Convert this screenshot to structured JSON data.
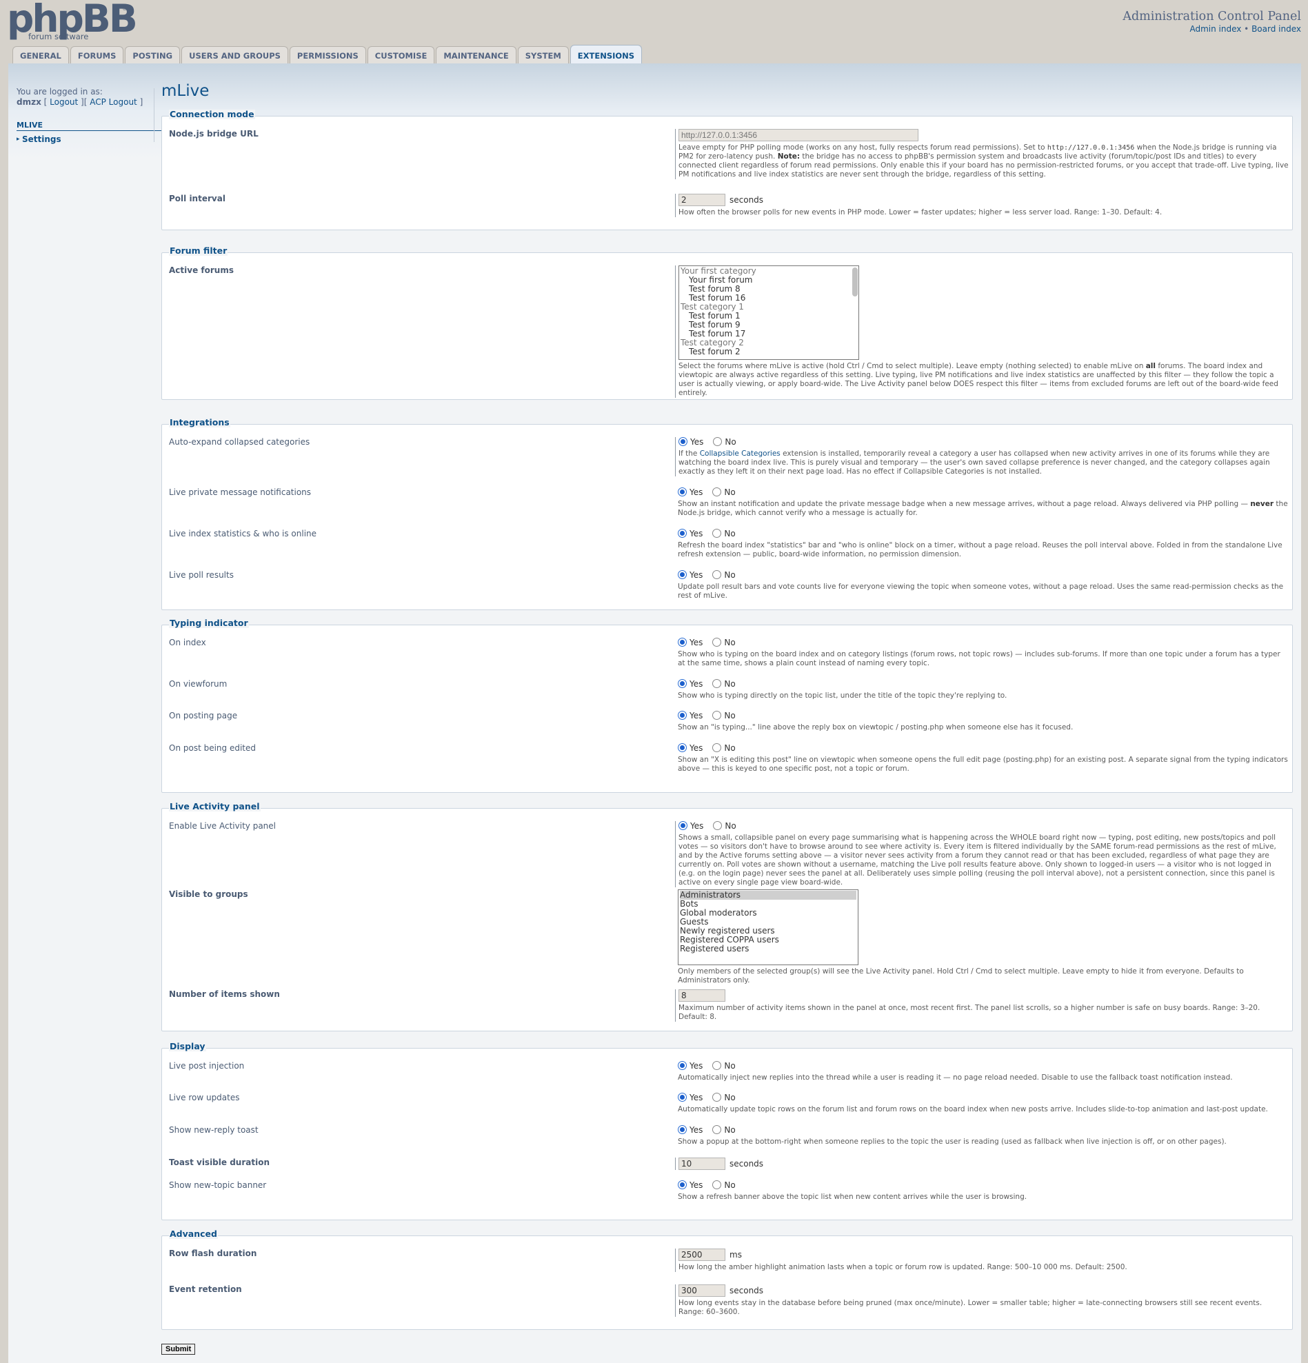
{
  "header": {
    "logo_text": "phpBB",
    "logo_sub": "forum software",
    "logo_reg": "®",
    "title": "Administration Control Panel",
    "link_admin": "Admin index",
    "separator": "•",
    "link_board": "Board index"
  },
  "tabs": [
    "GENERAL",
    "FORUMS",
    "POSTING",
    "USERS AND GROUPS",
    "PERMISSIONS",
    "CUSTOMISE",
    "MAINTENANCE",
    "SYSTEM",
    "EXTENSIONS"
  ],
  "menu": {
    "logged_in_label": "You are logged in as:",
    "username": "dmzx",
    "logout": "Logout",
    "acp_logout": "ACP Logout",
    "section": "MLIVE",
    "item": "Settings"
  },
  "page_title": "mLive",
  "sections": {
    "connection": {
      "legend": "Connection mode",
      "bridge": {
        "label": "Node.js bridge URL",
        "placeholder": "http://127.0.0.1:3456",
        "ex_a": "Leave empty for PHP polling mode (works on any host, fully respects forum read permissions). Set to ",
        "ex_code": "http://127.0.0.1:3456",
        "ex_b": " when the Node.js bridge is running via PM2 for zero-latency push. ",
        "ex_note": "Note:",
        "ex_c": " the bridge has no access to phpBB's permission system and broadcasts live activity (forum/topic/post IDs and titles) to every connected client regardless of forum read permissions. Only enable this if your board has no permission-restricted forums, or you accept that trade-off. Live typing, live PM notifications and live index statistics are never sent through the bridge, regardless of this setting."
      },
      "poll": {
        "label": "Poll interval",
        "value": "2",
        "unit": "seconds",
        "ex": "How often the browser polls for new events in PHP mode. Lower = faster updates; higher = less server load. Range: 1–30. Default: 4."
      }
    },
    "forum_filter": {
      "legend": "Forum filter",
      "label": "Active forums",
      "options": [
        {
          "t": "Your first category",
          "k": "grp"
        },
        {
          "t": "Your first forum",
          "k": "ind"
        },
        {
          "t": "Test forum 8",
          "k": "ind"
        },
        {
          "t": "Test forum 16",
          "k": "ind"
        },
        {
          "t": "Test category 1",
          "k": "grp"
        },
        {
          "t": "Test forum 1",
          "k": "ind"
        },
        {
          "t": "Test forum 9",
          "k": "ind"
        },
        {
          "t": "Test forum 17",
          "k": "ind"
        },
        {
          "t": "Test category 2",
          "k": "grp"
        },
        {
          "t": "Test forum 2",
          "k": "ind"
        }
      ],
      "ex_a": "Select the forums where mLive is active (hold Ctrl / Cmd to select multiple). Leave empty (nothing selected) to enable mLive on ",
      "ex_b": "all",
      "ex_c": " forums. The board index and viewtopic are always active regardless of this setting. Live typing, live PM notifications and live index statistics are unaffected by this filter — they follow the topic a user is actually viewing, or apply board-wide. The Live Activity panel below DOES respect this filter — items from excluded forums are left out of the board-wide feed entirely."
    },
    "integrations": {
      "legend": "Integrations",
      "auto_expand": {
        "label": "Auto-expand collapsed categories",
        "ex_a": "If the ",
        "ex_link": "Collapsible Categories",
        "ex_b": " extension is installed, temporarily reveal a category a user has collapsed when new activity arrives in one of its forums while they are watching the board index live. This is purely visual and temporary — the user's own saved collapse preference is never changed, and the category collapses again exactly as they left it on their next page load. Has no effect if Collapsible Categories is not installed."
      },
      "pm": {
        "label": "Live private message notifications",
        "ex_a": "Show an instant notification and update the private message badge when a new message arrives, without a page reload. Always delivered via PHP polling — ",
        "ex_b": "never",
        "ex_c": " the Node.js bridge, which cannot verify who a message is actually for."
      },
      "stats": {
        "label": "Live index statistics & who is online",
        "ex": "Refresh the board index \"statistics\" bar and \"who is online\" block on a timer, without a page reload. Reuses the poll interval above. Folded in from the standalone Live refresh extension — public, board-wide information, no permission dimension."
      },
      "polls": {
        "label": "Live poll results",
        "ex": "Update poll result bars and vote counts live for everyone viewing the topic when someone votes, without a page reload. Uses the same read-permission checks as the rest of mLive."
      }
    },
    "typing": {
      "legend": "Typing indicator",
      "index": {
        "label": "On index",
        "ex": "Show who is typing on the board index and on category listings (forum rows, not topic rows) — includes sub-forums. If more than one topic under a forum has a typer at the same time, shows a plain count instead of naming every topic."
      },
      "viewforum": {
        "label": "On viewforum",
        "ex": "Show who is typing directly on the topic list, under the title of the topic they're replying to."
      },
      "posting": {
        "label": "On posting page",
        "ex": "Show an \"is typing...\" line above the reply box on viewtopic / posting.php when someone else has it focused."
      },
      "edited": {
        "label": "On post being edited",
        "ex": "Show an \"X is editing this post\" line on viewtopic when someone opens the full edit page (posting.php) for an existing post. A separate signal from the typing indicators above — this is keyed to one specific post, not a topic or forum."
      }
    },
    "activity": {
      "legend": "Live Activity panel",
      "enable": {
        "label": "Enable Live Activity panel",
        "ex": "Shows a small, collapsible panel on every page summarising what is happening across the WHOLE board right now — typing, post editing, new posts/topics and poll votes — so visitors don't have to browse around to see where activity is. Every item is filtered individually by the SAME forum-read permissions as the rest of mLive, and by the Active forums setting above — a visitor never sees activity from a forum they cannot read or that has been excluded, regardless of what page they are currently on. Poll votes are shown without a username, matching the Live poll results feature above. Only shown to logged-in users — a visitor who is not logged in (e.g. on the login page) never sees the panel at all. Deliberately uses simple polling (reusing the poll interval above), not a persistent connection, since this panel is active on every single page view board-wide."
      },
      "groups": {
        "label": "Visible to groups",
        "options": [
          "Administrators",
          "Bots",
          "Global moderators",
          "Guests",
          "Newly registered users",
          "Registered COPPA users",
          "Registered users"
        ],
        "ex": "Only members of the selected group(s) will see the Live Activity panel. Hold Ctrl / Cmd to select multiple. Leave empty to hide it from everyone. Defaults to Administrators only."
      },
      "items": {
        "label": "Number of items shown",
        "value": "8",
        "ex": "Maximum number of activity items shown in the panel at once, most recent first. The panel list scrolls, so a higher number is safe on busy boards. Range: 3–20. Default: 8."
      }
    },
    "display": {
      "legend": "Display",
      "inject": {
        "label": "Live post injection",
        "ex": "Automatically inject new replies into the thread while a user is reading it — no page reload needed. Disable to use the fallback toast notification instead."
      },
      "rows": {
        "label": "Live row updates",
        "ex": "Automatically update topic rows on the forum list and forum rows on the board index when new posts arrive. Includes slide-to-top animation and last-post update."
      },
      "toast": {
        "label": "Show new-reply toast",
        "ex": "Show a popup at the bottom-right when someone replies to the topic the user is reading (used as fallback when live injection is off, or on other pages)."
      },
      "toast_dur": {
        "label": "Toast visible duration",
        "value": "10",
        "unit": "seconds"
      },
      "banner": {
        "label": "Show new-topic banner",
        "ex": "Show a refresh banner above the topic list when new content arrives while the user is browsing."
      }
    },
    "advanced": {
      "legend": "Advanced",
      "flash": {
        "label": "Row flash duration",
        "value": "2500",
        "unit": "ms",
        "ex": "How long the amber highlight animation lasts when a topic or forum row is updated. Range: 500–10 000 ms. Default: 2500."
      },
      "retention": {
        "label": "Event retention",
        "value": "300",
        "unit": "seconds",
        "ex": "How long events stay in the database before being pruned (max once/minute). Lower = smaller table; higher = late-connecting browsers still see recent events. Range: 60–3600."
      }
    }
  },
  "radio": {
    "yes": "Yes",
    "no": "No"
  },
  "submit": "Submit"
}
